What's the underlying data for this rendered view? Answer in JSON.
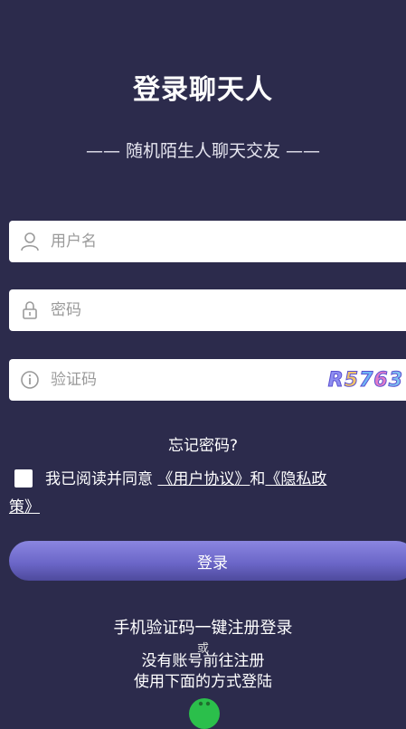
{
  "title": "登录聊天人",
  "subtitle": "—— 随机陌生人聊天交友 ——",
  "form": {
    "username_placeholder": "用户名",
    "password_placeholder": "密码",
    "captcha_placeholder": "验证码",
    "captcha_chars": [
      "R",
      "5",
      "7",
      "6",
      "3"
    ],
    "captcha_colors": [
      "#8e8ef0",
      "#f0c36a",
      "#6fb6f5",
      "#e07cc8",
      "#7ec0f0"
    ]
  },
  "forgot_password": "忘记密码?",
  "agreement": {
    "prefix": "我已阅读并同意",
    "user_agreement": "《用户协议》",
    "and": "和",
    "privacy_first": "《隐私政",
    "privacy_second": "策》"
  },
  "login_button": "登录",
  "sms_login": "手机验证码一键注册登录",
  "or_text": "或",
  "register_link": "没有账号前往注册",
  "other_ways": "使用下面的方式登陆",
  "colors": {
    "background": "#2c2b4c",
    "button_gradient_top": "#8a86e0",
    "button_gradient_bottom": "#4e4a9c",
    "wechat_green": "#2bbf4b"
  },
  "icons": {
    "username": "user-icon",
    "password": "lock-icon",
    "captcha": "info-icon",
    "social": "wechat-icon"
  }
}
